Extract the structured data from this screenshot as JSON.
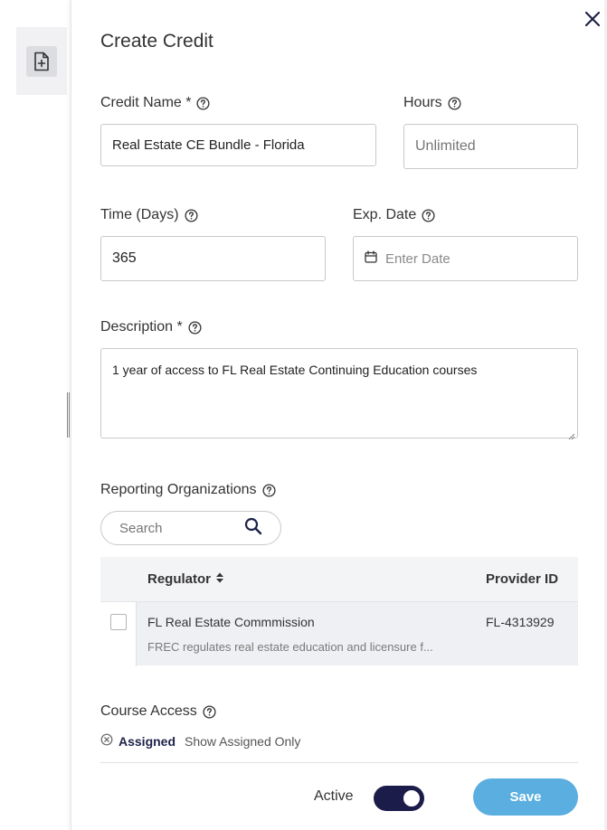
{
  "panel": {
    "title": "Create Credit"
  },
  "form": {
    "credit_name_label": "Credit Name *",
    "credit_name_value": "Real Estate CE Bundle - Florida",
    "hours_label": "Hours",
    "hours_placeholder": "Unlimited",
    "time_label": "Time (Days)",
    "time_value": "365",
    "exp_date_label": "Exp. Date",
    "exp_date_placeholder": "Enter Date",
    "description_label": "Description *",
    "description_value": "1 year of access to FL Real Estate Continuing Education courses"
  },
  "reporting": {
    "label": "Reporting Organizations",
    "search_placeholder": "Search",
    "columns": {
      "regulator": "Regulator",
      "provider_id": "Provider ID"
    },
    "rows": [
      {
        "name": "FL Real Estate Commmission",
        "description": "FREC regulates real estate education and licensure f...",
        "provider_id": "FL-4313929"
      }
    ]
  },
  "course_access": {
    "label": "Course Access",
    "filter_label": "Assigned",
    "filter_hint": "Show Assigned Only"
  },
  "footer": {
    "active_label": "Active",
    "active_on": true,
    "save_label": "Save"
  },
  "colors": {
    "accent_dark": "#1b1c4a",
    "save_button": "#5aaee0"
  },
  "icons": [
    "file-plus-icon",
    "close-icon",
    "help-icon",
    "calendar-icon",
    "search-icon",
    "sort-icon",
    "clear-circle-icon"
  ]
}
